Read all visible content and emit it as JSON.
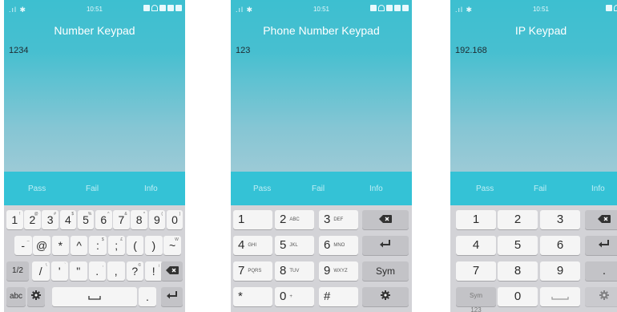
{
  "status": {
    "time": "10:51"
  },
  "actions": {
    "pass": "Pass",
    "fail": "Fail",
    "info": "Info"
  },
  "screens": [
    {
      "title": "Number Keypad",
      "value": "1234"
    },
    {
      "title": "Phone Number Keypad",
      "value": "123"
    },
    {
      "title": "IP Keypad",
      "value": "192.168"
    }
  ],
  "number_keyboard": {
    "row1": [
      {
        "main": "1",
        "sub": "!"
      },
      {
        "main": "2",
        "sub": "@"
      },
      {
        "main": "3",
        "sub": "#"
      },
      {
        "main": "4",
        "sub": "$"
      },
      {
        "main": "5",
        "sub": "%"
      },
      {
        "main": "6",
        "sub": "^"
      },
      {
        "main": "7",
        "sub": "&"
      },
      {
        "main": "8",
        "sub": "*"
      },
      {
        "main": "9",
        "sub": "("
      },
      {
        "main": "0",
        "sub": ")"
      }
    ],
    "row2": [
      {
        "main": "-",
        "sub": "_"
      },
      {
        "main": "@",
        "sub": ""
      },
      {
        "main": "*",
        "sub": ""
      },
      {
        "main": "^",
        "sub": ""
      },
      {
        "main": ":",
        "sub": "$"
      },
      {
        "main": ";",
        "sub": "£"
      },
      {
        "main": "(",
        "sub": ""
      },
      {
        "main": ")",
        "sub": ""
      },
      {
        "main": "~",
        "sub": "W"
      }
    ],
    "row3": [
      {
        "main": "/",
        "sub": "\\"
      },
      {
        "main": "'",
        "sub": "`"
      },
      {
        "main": "\"",
        "sub": ""
      },
      {
        "main": ".",
        "sub": ","
      },
      {
        "main": ",",
        "sub": ""
      },
      {
        "main": "?",
        "sub": "©"
      },
      {
        "main": "!",
        "sub": "¡"
      }
    ],
    "mode_label": "1/2",
    "abc_label": "abc"
  },
  "phone_keyboard": [
    {
      "main": "1",
      "alpha": ""
    },
    {
      "main": "2",
      "alpha": "ABC"
    },
    {
      "main": "3",
      "alpha": "DEF"
    },
    {
      "main": "4",
      "alpha": "GHI"
    },
    {
      "main": "5",
      "alpha": "JKL"
    },
    {
      "main": "6",
      "alpha": "MNO"
    },
    {
      "main": "7",
      "alpha": "PQRS"
    },
    {
      "main": "8",
      "alpha": "TUV"
    },
    {
      "main": "9",
      "alpha": "WXYZ"
    },
    {
      "main": "*",
      "alpha": ""
    },
    {
      "main": "0",
      "alpha": "+"
    },
    {
      "main": "#",
      "alpha": ""
    }
  ],
  "phone_sym_label": "Sym",
  "ip_keyboard": [
    "1",
    "2",
    "3",
    "4",
    "5",
    "6",
    "7",
    "8",
    "9",
    "0"
  ],
  "ip_dot_label": ".",
  "ip_sym_label": "Sym",
  "ip_sym_sub": "123"
}
